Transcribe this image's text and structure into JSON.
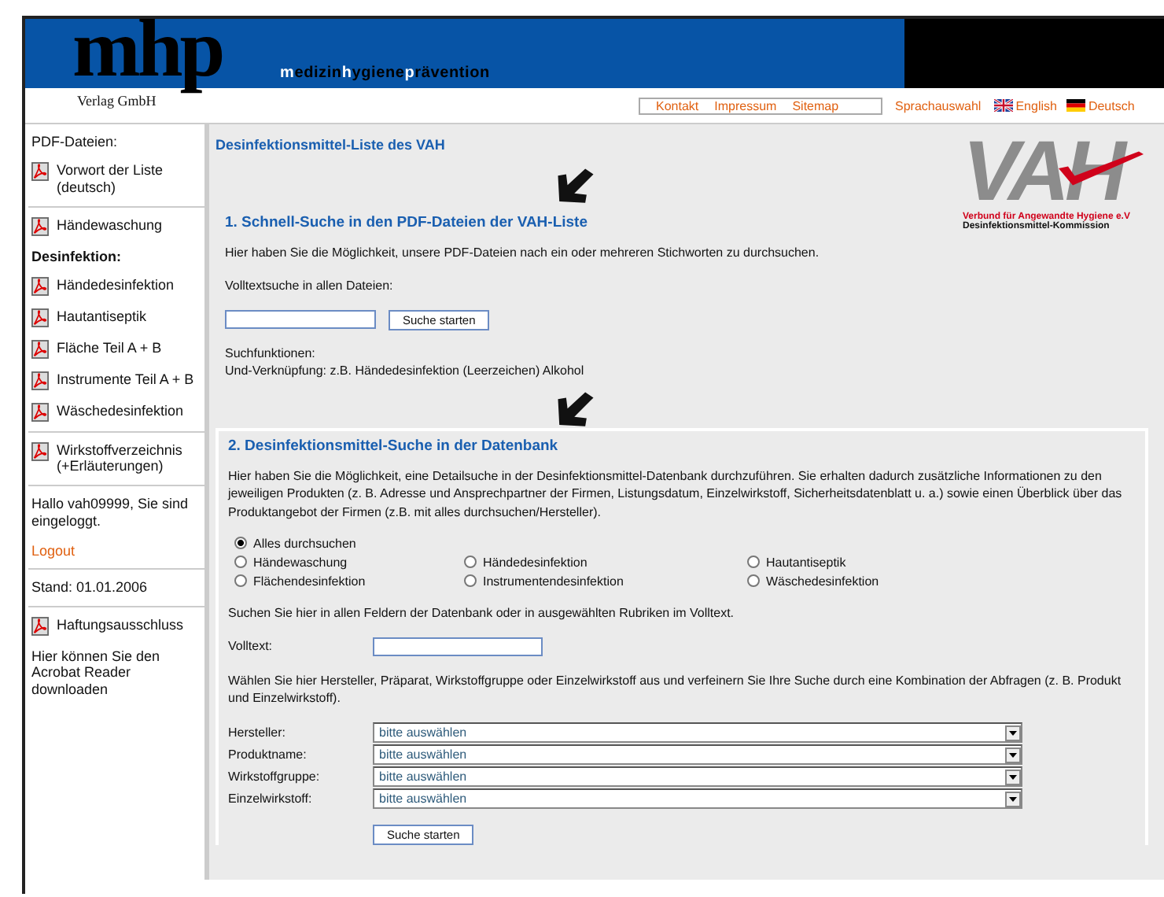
{
  "header": {
    "logo": "mhp",
    "publisher": "Verlag GmbH",
    "tagline": [
      {
        "text": "m",
        "highlight": true
      },
      {
        "text": "edizin",
        "highlight": false
      },
      {
        "text": "h",
        "highlight": true
      },
      {
        "text": "ygiene",
        "highlight": false
      },
      {
        "text": "p",
        "highlight": true
      },
      {
        "text": "rävention",
        "highlight": false
      }
    ],
    "links": [
      "Kontakt",
      "Impressum",
      "Sitemap"
    ],
    "language_label": "Sprachauswahl",
    "languages": [
      {
        "label": "English"
      },
      {
        "label": "Deutsch"
      }
    ]
  },
  "sidebar": {
    "sections": [
      {
        "items": [
          {
            "kind": "heading",
            "text": "PDF-Dateien:"
          },
          {
            "kind": "pdf",
            "text": "Vorwort der Liste (deutsch)"
          }
        ]
      },
      {
        "items": [
          {
            "kind": "pdf",
            "text": "Händewaschung"
          },
          {
            "kind": "heading",
            "text": "Desinfektion:"
          },
          {
            "kind": "pdf",
            "text": "Händedesinfektion"
          },
          {
            "kind": "pdf",
            "text": "Hautantiseptik"
          },
          {
            "kind": "pdf",
            "text": "Fläche Teil A + B"
          },
          {
            "kind": "pdf",
            "text": "Instrumente Teil A + B"
          },
          {
            "kind": "pdf",
            "text": "Wäschedesinfektion"
          }
        ]
      },
      {
        "items": [
          {
            "kind": "pdf",
            "text": "Wirkstoffverzeichnis (+Erläuterungen)"
          }
        ]
      },
      {
        "items": [
          {
            "kind": "text",
            "text": "Hallo vah09999, Sie sind eingeloggt."
          },
          {
            "kind": "link",
            "text": "Logout"
          }
        ]
      },
      {
        "items": [
          {
            "kind": "text",
            "text": "Stand:  01.01.2006"
          }
        ]
      },
      {
        "items": [
          {
            "kind": "pdf",
            "text": "Haftungsausschluss"
          },
          {
            "kind": "text",
            "text": "Hier können Sie den Acrobat Reader downloaden"
          }
        ]
      }
    ]
  },
  "main": {
    "title": "Desinfektionsmittel-Liste des VAH",
    "vah_logo": {
      "letters": "VAH",
      "line1": "Verbund für Angewandte Hygiene e.V",
      "line2": "Desinfektionsmittel-Kommission"
    },
    "section1": {
      "heading": "1. Schnell-Suche in den PDF-Dateien der VAH-Liste",
      "intro": "Hier haben Sie die Möglichkeit, unsere PDF-Dateien nach ein oder mehreren Stichworten zu durchsuchen.",
      "field_label": "Volltextsuche in allen Dateien:",
      "button": "Suche starten",
      "help": [
        "Suchfunktionen:",
        "Und-Verknüpfung: z.B. Händedesinfektion (Leerzeichen) Alkohol"
      ]
    },
    "section2": {
      "heading": "2. Desinfektionsmittel-Suche in der Datenbank",
      "intro": "Hier haben Sie die Möglichkeit, eine Detailsuche in der Desinfektionsmittel-Datenbank durchzuführen. Sie erhalten dadurch zusätzliche Informationen zu den jeweiligen Produkten (z. B. Adresse und Ansprechpartner der Firmen, Listungsdatum, Einzelwirkstoff, Sicherheitsdatenblatt u. a.) sowie einen Überblick über das Produktangebot der Firmen (z.B. mit alles durchsuchen/Hersteller).",
      "radios": [
        {
          "label": "Alles durchsuchen",
          "selected": true
        },
        {
          "label": "Händewaschung",
          "selected": false
        },
        {
          "label": "Händedesinfektion",
          "selected": false
        },
        {
          "label": "Hautantiseptik",
          "selected": false
        },
        {
          "label": "Flächendesinfektion",
          "selected": false
        },
        {
          "label": "Instrumentendesinfektion",
          "selected": false
        },
        {
          "label": "Wäschedesinfektion",
          "selected": false
        }
      ],
      "volltext_hint": "Suchen Sie hier in allen Feldern der Datenbank oder in ausgewählten Rubriken im Volltext.",
      "volltext_label": "Volltext:",
      "filter_hint": "Wählen Sie hier Hersteller, Präparat, Wirkstoffgruppe oder Einzelwirkstoff aus und verfeinern Sie Ihre Suche durch eine Kombination der Abfragen (z. B. Produkt und Einzelwirkstoff).",
      "selects": [
        {
          "label": "Hersteller:",
          "value": "bitte auswählen"
        },
        {
          "label": "Produktname:",
          "value": "bitte auswählen"
        },
        {
          "label": "Wirkstoffgruppe:",
          "value": "bitte auswählen"
        },
        {
          "label": "Einzelwirkstoff:",
          "value": "bitte auswählen"
        }
      ],
      "button": "Suche starten"
    }
  }
}
